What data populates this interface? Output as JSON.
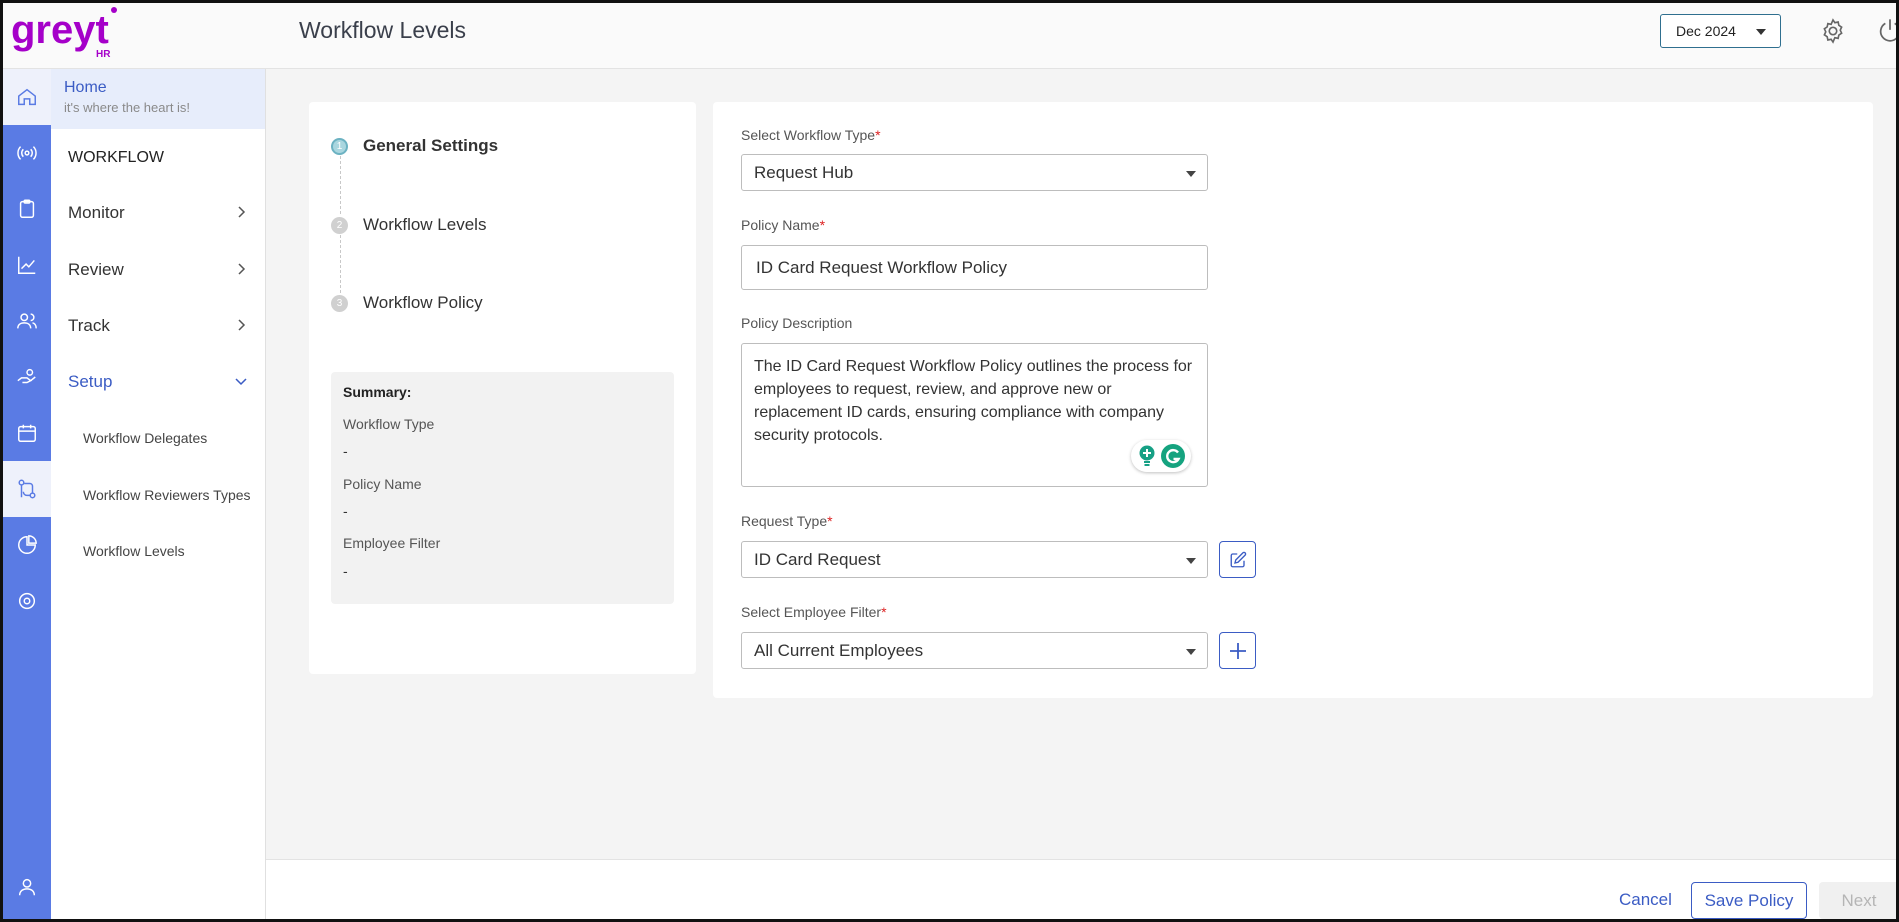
{
  "app": {
    "logo_text": "greyt",
    "logo_sub": "HR",
    "brand_color": "#a500c9"
  },
  "header": {
    "title": "Workflow Levels",
    "month": "Dec 2024"
  },
  "sidenav": {
    "home_title": "Home",
    "home_subtitle": "it's where the heart is!",
    "section": "WORKFLOW",
    "items": [
      {
        "label": "Monitor"
      },
      {
        "label": "Review"
      },
      {
        "label": "Track"
      },
      {
        "label": "Setup"
      }
    ],
    "setup_items": [
      {
        "label": "Workflow Delegates"
      },
      {
        "label": "Workflow Reviewers Types"
      },
      {
        "label": "Workflow Levels"
      }
    ]
  },
  "stepper": {
    "steps": [
      {
        "num": "1",
        "label": "General Settings"
      },
      {
        "num": "2",
        "label": "Workflow Levels"
      },
      {
        "num": "3",
        "label": "Workflow Policy"
      }
    ],
    "summary": {
      "title": "Summary:",
      "workflow_type_label": "Workflow Type",
      "workflow_type_value": "-",
      "policy_name_label": "Policy Name",
      "policy_name_value": "-",
      "employee_filter_label": "Employee Filter",
      "employee_filter_value": "-"
    }
  },
  "form": {
    "workflow_type_label": "Select Workflow Type",
    "workflow_type_value": "Request Hub",
    "policy_name_label": "Policy Name",
    "policy_name_value": "ID Card Request Workflow Policy",
    "policy_desc_label": "Policy Description",
    "policy_desc_value": "The ID Card Request Workflow Policy outlines the process for employees to request, review, and approve new or replacement ID cards, ensuring compliance with company security protocols.",
    "request_type_label": "Request Type",
    "request_type_value": "ID Card Request",
    "employee_filter_label": "Select Employee Filter",
    "employee_filter_value": "All Current Employees",
    "required_mark": "*"
  },
  "footer": {
    "cancel": "Cancel",
    "save": "Save Policy",
    "next": "Next"
  },
  "colors": {
    "rail": "#5a7be4",
    "accent": "#3b5cc4"
  }
}
